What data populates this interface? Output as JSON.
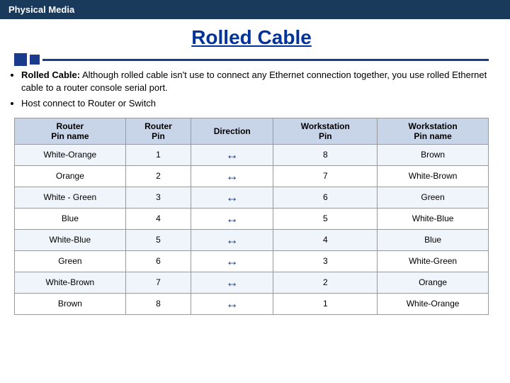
{
  "header": {
    "title": "Physical Media"
  },
  "page": {
    "title": "Rolled Cable"
  },
  "bullets": [
    {
      "text": "Rolled Cable: Although rolled cable isn't use to connect any Ethernet connection together, you use rolled Ethernet cable to a router console serial port.",
      "bold_prefix": "Rolled Cable:"
    },
    {
      "text": "Host connect to Router or Switch",
      "bold_prefix": ""
    }
  ],
  "table": {
    "headers": [
      "Router\nPin name",
      "Router\nPin",
      "Direction",
      "Workstation\nPin",
      "Workstation\nPin name"
    ],
    "rows": [
      {
        "router_pin_name": "White-Orange",
        "router_pin": "1",
        "direction": "↔",
        "ws_pin": "8",
        "ws_pin_name": "Brown"
      },
      {
        "router_pin_name": "Orange",
        "router_pin": "2",
        "direction": "↔",
        "ws_pin": "7",
        "ws_pin_name": "White-Brown"
      },
      {
        "router_pin_name": "White - Green",
        "router_pin": "3",
        "direction": "↔",
        "ws_pin": "6",
        "ws_pin_name": "Green"
      },
      {
        "router_pin_name": "Blue",
        "router_pin": "4",
        "direction": "↔",
        "ws_pin": "5",
        "ws_pin_name": "White-Blue"
      },
      {
        "router_pin_name": "White-Blue",
        "router_pin": "5",
        "direction": "↔",
        "ws_pin": "4",
        "ws_pin_name": "Blue"
      },
      {
        "router_pin_name": "Green",
        "router_pin": "6",
        "direction": "↔",
        "ws_pin": "3",
        "ws_pin_name": "White-Green"
      },
      {
        "router_pin_name": "White-Brown",
        "router_pin": "7",
        "direction": "↔",
        "ws_pin": "2",
        "ws_pin_name": "Orange"
      },
      {
        "router_pin_name": "Brown",
        "router_pin": "8",
        "direction": "↔",
        "ws_pin": "1",
        "ws_pin_name": "White-Orange"
      }
    ]
  }
}
